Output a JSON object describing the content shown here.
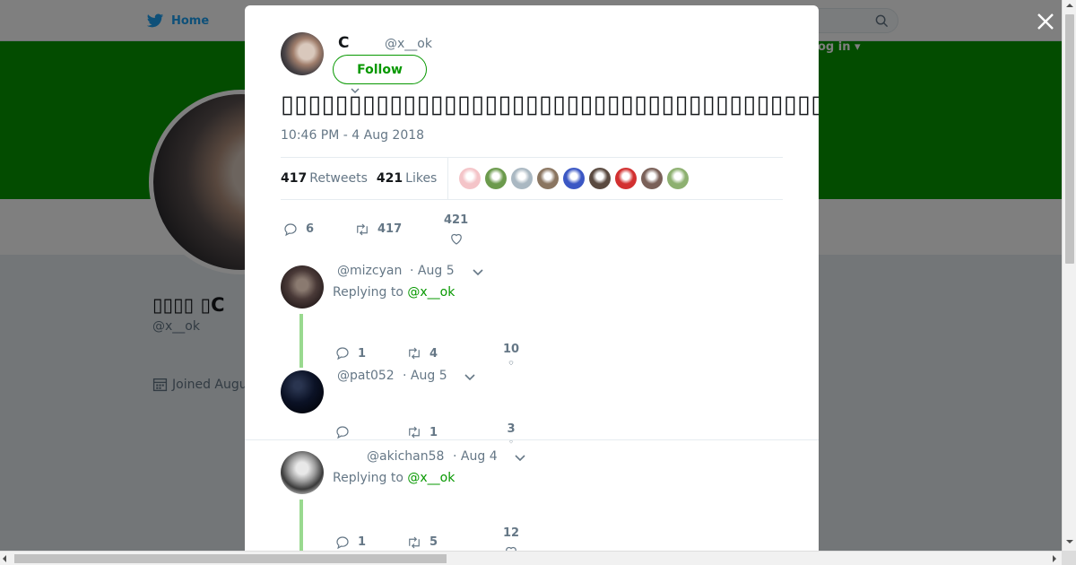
{
  "background": {
    "home_label": "Home",
    "login_label": "og in ▾",
    "profile_name": "▯▯▯▯ ▯C",
    "profile_handle": "@x__ok",
    "joined_label": "Joined Augu"
  },
  "tweet": {
    "author_name": "C",
    "author_handle": "@x__ok",
    "follow_label": "Follow",
    "text": "▯▯▯▯▯▯▯▯▯▯▯▯▯▯▯▯▯▯▯▯▯▯▯▯▯▯▯▯▯▯▯▯▯▯▯▯▯▯▯▯▯▯▯▯▯▯▯▯▯",
    "timestamp": "10:46 PM - 4 Aug 2018",
    "retweets_count": "417",
    "retweets_label": "Retweets",
    "likes_count": "421",
    "likes_label": "Likes",
    "reply_count": "6",
    "retweet_count": "417",
    "like_count": "421",
    "liker_colors": [
      "#f4c4c8",
      "#6b9a4c",
      "#aab8c2",
      "#8a7560",
      "#3b57c4",
      "#5a4a40",
      "#d23030",
      "#7a6058",
      "#8db070"
    ]
  },
  "replies": [
    {
      "handle": "@mizcyan",
      "date": "· Aug 5",
      "replying_prefix": "Replying to",
      "replying_to": "@x__ok",
      "reply_count": "1",
      "retweet_count": "4",
      "like_count": "10",
      "avatar_color": "#4a3a38"
    },
    {
      "handle": "@pat052",
      "date": "· Aug 5",
      "reply_count": "",
      "retweet_count": "1",
      "like_count": "3",
      "avatar_color": "#0b1226"
    },
    {
      "handle": "@akichan58",
      "date": "· Aug 4",
      "replying_prefix": "Replying to",
      "replying_to": "@x__ok",
      "reply_count": "1",
      "retweet_count": "5",
      "like_count": "12",
      "avatar_color": "#9a9a9a"
    }
  ]
}
